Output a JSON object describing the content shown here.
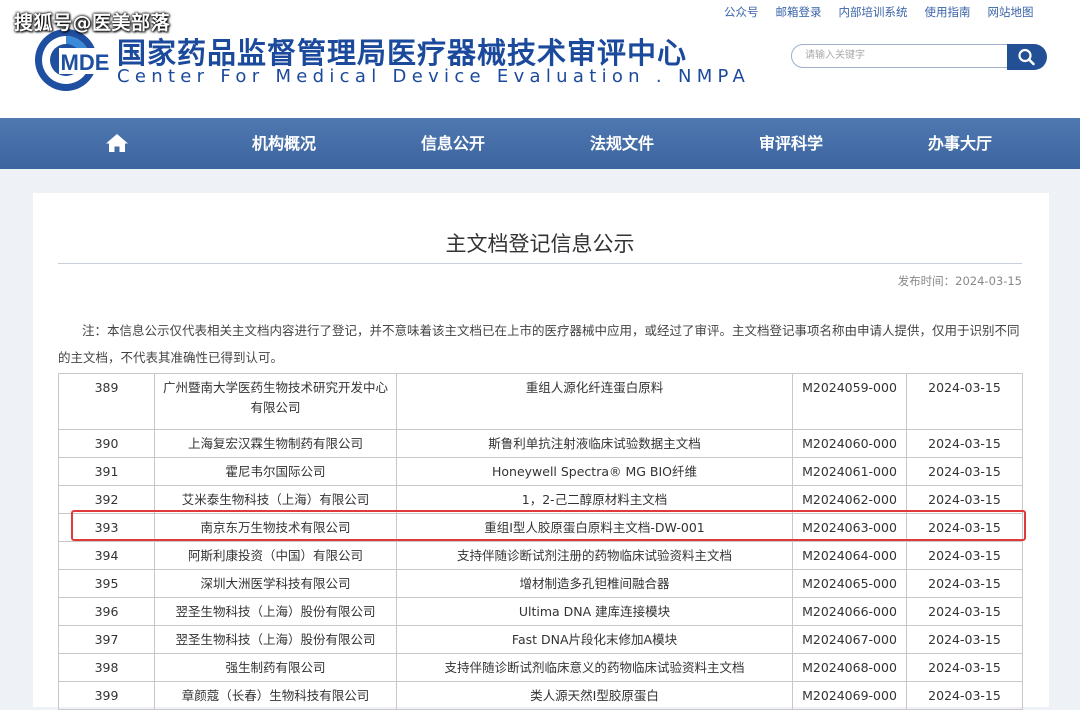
{
  "watermark": "搜狐号@医美部落",
  "site": {
    "logo_text": "MDE",
    "title_cn": "国家药品监督管理局医疗器械技术审评中心",
    "title_en": "Center For Medical Device Evaluation . NMPA"
  },
  "top_links": [
    "公众号",
    "邮箱登录",
    "内部培训系统",
    "使用指南",
    "网站地图"
  ],
  "search": {
    "placeholder": "请输入关键字",
    "icon": "search-icon"
  },
  "nav": {
    "home_icon": "home-icon",
    "items": [
      "机构概况",
      "信息公开",
      "法规文件",
      "审评科学",
      "办事大厅"
    ]
  },
  "article": {
    "title": "主文档登记信息公示",
    "publish_date": "发布时间：2024-03-15",
    "note": "注：本信息公示仅代表相关主文档内容进行了登记，并不意味着该主文档已在上市的医疗器械中应用，或经过了审评。主文档登记事项名称由申请人提供，仅用于识别不同的主文档，不代表其准确性已得到认可。"
  },
  "table": {
    "rows": [
      [
        "389",
        "广州暨南大学医药生物技术研究开发中心有限公司",
        "重组人源化纤连蛋白原料",
        "M2024059-000",
        "2024-03-15"
      ],
      [
        "390",
        "上海复宏汉霖生物制药有限公司",
        "斯鲁利单抗注射液临床试验数据主文档",
        "M2024060-000",
        "2024-03-15"
      ],
      [
        "391",
        "霍尼韦尔国际公司",
        "Honeywell Spectra® MG BIO纤维",
        "M2024061-000",
        "2024-03-15"
      ],
      [
        "392",
        "艾米泰生物科技（上海）有限公司",
        "1，2-己二醇原材料主文档",
        "M2024062-000",
        "2024-03-15"
      ],
      [
        "393",
        "南京东万生物技术有限公司",
        "重组Ⅰ型人胶原蛋白原料主文档-DW-001",
        "M2024063-000",
        "2024-03-15"
      ],
      [
        "394",
        "阿斯利康投资（中国）有限公司",
        "支持伴随诊断试剂注册的药物临床试验资料主文档",
        "M2024064-000",
        "2024-03-15"
      ],
      [
        "395",
        "深圳大洲医学科技有限公司",
        "增材制造多孔钽椎间融合器",
        "M2024065-000",
        "2024-03-15"
      ],
      [
        "396",
        "翌圣生物科技（上海）股份有限公司",
        "Ultima DNA 建库连接模块",
        "M2024066-000",
        "2024-03-15"
      ],
      [
        "397",
        "翌圣生物科技（上海）股份有限公司",
        "Fast DNA片段化末修加A模块",
        "M2024067-000",
        "2024-03-15"
      ],
      [
        "398",
        "强生制药有限公司",
        "支持伴随诊断试剂临床意义的药物临床试验资料主文档",
        "M2024068-000",
        "2024-03-15"
      ],
      [
        "399",
        "章颜蔻（长春）生物科技有限公司",
        "类人源天然Ⅰ型胶原蛋白",
        "M2024069-000",
        "2024-03-15"
      ]
    ],
    "highlight_color": "#e03a3a"
  },
  "colors": {
    "brand": "#1b4a9c",
    "nav": "#4670aa",
    "highlight": "#e03a3a"
  }
}
